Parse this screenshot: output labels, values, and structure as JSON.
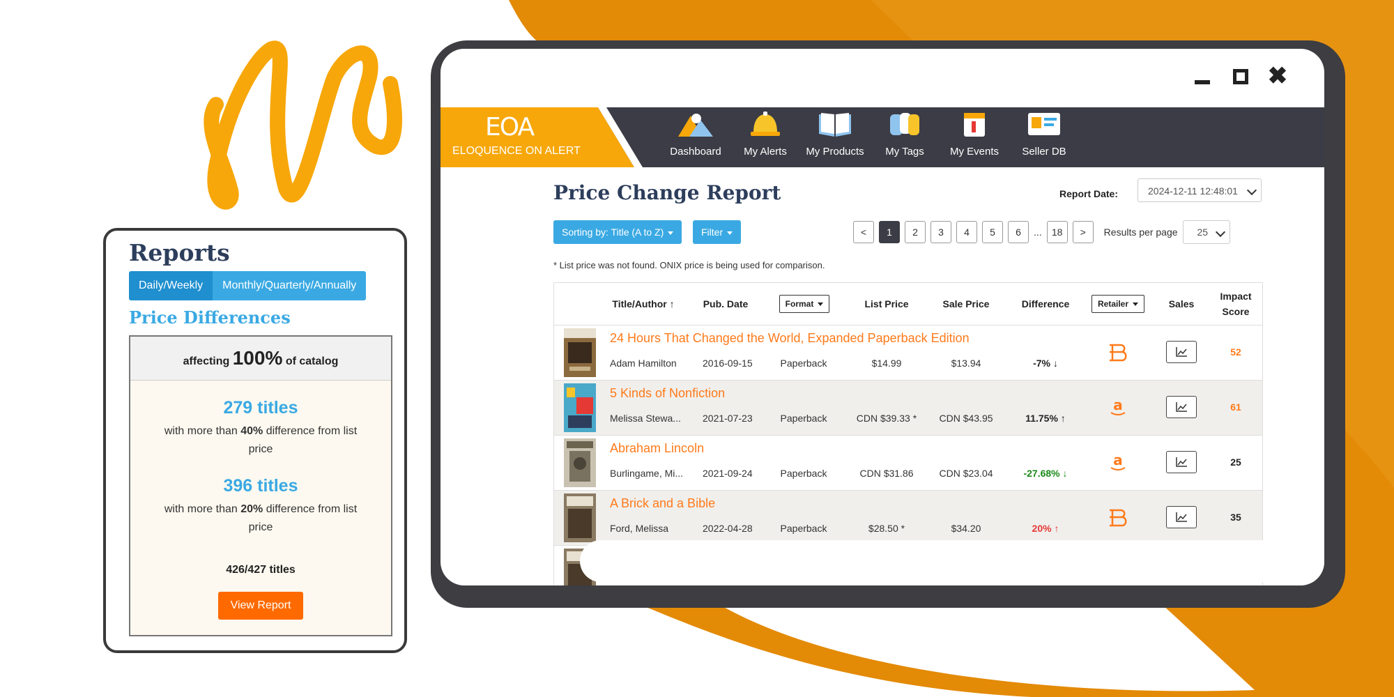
{
  "colors": {
    "orange_bg": "#e38a07",
    "orange_accent": "#ff7a1a",
    "nav_dark": "#3b3c45",
    "blue": "#3aa9e3",
    "navy_title": "#2d3e5c"
  },
  "reports_card": {
    "title": "Reports",
    "tabs": [
      "Daily/Weekly",
      "Monthly/Quarterly/Annually"
    ],
    "section_title": "Price Differences",
    "affecting_prefix": "affecting",
    "affecting_value": "100%",
    "affecting_suffix": "of catalog",
    "stat1_count": "279 titles",
    "stat1_prefix": "with more than",
    "stat1_pct": "40%",
    "stat1_suffix": "difference from list price",
    "stat2_count": "396 titles",
    "stat2_prefix": "with more than",
    "stat2_pct": "20%",
    "stat2_suffix": "difference from list price",
    "total": "426/427 titles",
    "button": "View Report"
  },
  "app": {
    "logo_mark": "EOA",
    "logo_text": "ELOQUENCE ON ALERT",
    "nav": [
      {
        "label": "Dashboard",
        "icon": "mountains-icon"
      },
      {
        "label": "My Alerts",
        "icon": "alert-bell-icon"
      },
      {
        "label": "My Products",
        "icon": "open-book-icon"
      },
      {
        "label": "My Tags",
        "icon": "tags-icon"
      },
      {
        "label": "My Events",
        "icon": "calendar-icon"
      },
      {
        "label": "Seller DB",
        "icon": "seller-card-icon"
      }
    ]
  },
  "report": {
    "title": "Price Change Report",
    "date_label": "Report Date:",
    "date_value": "2024-12-11 12:48:01",
    "sort_button": "Sorting by: Title (A to Z)",
    "filter_button": "Filter",
    "pagination": {
      "prev": "<",
      "pages": [
        "1",
        "2",
        "3",
        "4",
        "5",
        "6"
      ],
      "ellipsis": "...",
      "last": "18",
      "next": ">",
      "current": "1"
    },
    "results_per_page_label": "Results per page",
    "results_per_page_value": "25",
    "note": "* List price was not found. ONIX price is being used for comparison.",
    "columns": {
      "title_author": "Title/Author ↑",
      "pub_date": "Pub. Date",
      "format": "Format",
      "list_price": "List Price",
      "sale_price": "Sale Price",
      "difference": "Difference",
      "retailer": "Retailer",
      "sales": "Sales",
      "impact_score": "Impact Score"
    },
    "rows": [
      {
        "title": "24 Hours That Changed the World, Expanded Paperback Edition",
        "author": "Adam Hamilton",
        "pub_date": "2016-09-15",
        "format": "Paperback",
        "list_price": "$14.99",
        "sale_price": "$13.94",
        "difference": "-7% ↓",
        "retailer": "barnes-noble",
        "impact_score": "52",
        "score_color": "#ff7a1a"
      },
      {
        "title": "5 Kinds of Nonfiction",
        "author": "Melissa Stewa...",
        "pub_date": "2021-07-23",
        "format": "Paperback",
        "list_price": "CDN $39.33 *",
        "sale_price": "CDN $43.95",
        "difference": "11.75% ↑",
        "retailer": "amazon",
        "impact_score": "61",
        "score_color": "#ff7a1a"
      },
      {
        "title": "Abraham Lincoln",
        "author": "Burlingame, Mi...",
        "pub_date": "2021-09-24",
        "format": "Paperback",
        "list_price": "CDN $31.86",
        "sale_price": "CDN $23.04",
        "difference": "-27.68% ↓",
        "retailer": "amazon",
        "impact_score": "25",
        "score_color": "#222222"
      },
      {
        "title": "A Brick and a Bible",
        "author": "Ford, Melissa",
        "pub_date": "2022-04-28",
        "format": "Paperback",
        "list_price": "$28.50 *",
        "sale_price": "$34.20",
        "difference": "20% ↑",
        "retailer": "barnes-noble",
        "impact_score": "35",
        "score_color": "#222222"
      }
    ]
  }
}
